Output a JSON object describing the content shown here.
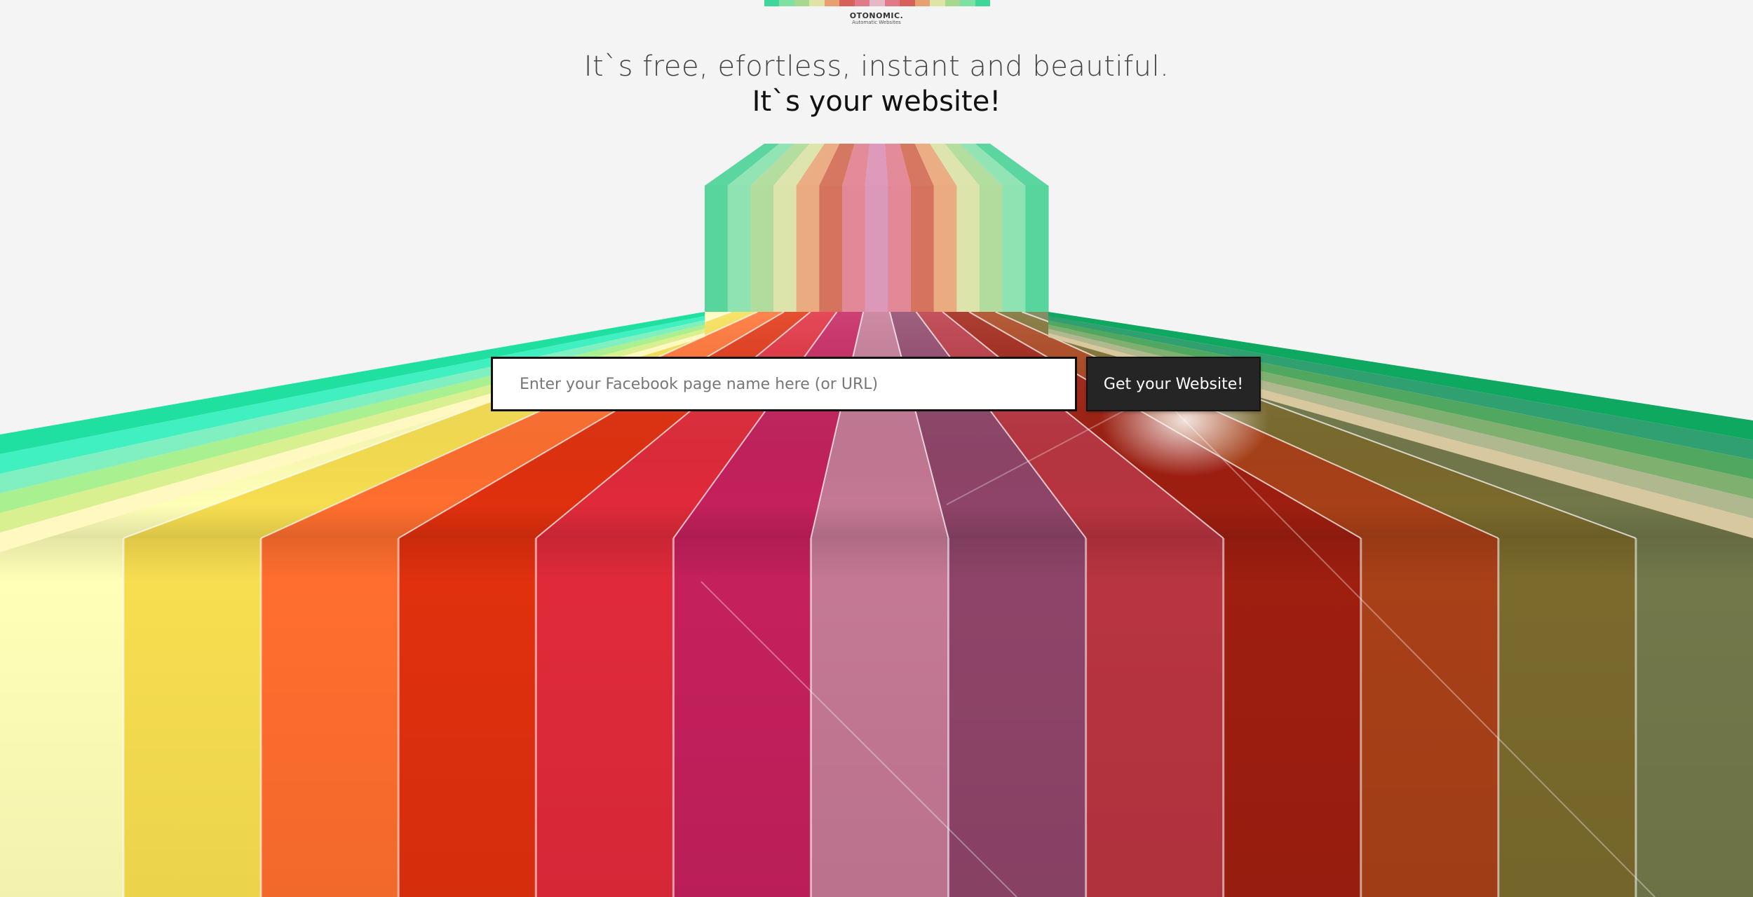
{
  "brand": {
    "name": "OTONOMIC.",
    "tagline": "Automatic Websites"
  },
  "hero": {
    "headline": "It`s free, efortless, instant and beautiful.",
    "subheadline": "It`s your website!"
  },
  "form": {
    "placeholder": "Enter your Facebook page name here (or URL)",
    "value": "",
    "submit_label": "Get your Website!"
  },
  "palette": [
    "#ffffb8",
    "#f7de50",
    "#ff6e2e",
    "#e0300e",
    "#e02a3a",
    "#c4205c",
    "#c47894",
    "#8e4468",
    "#b83440",
    "#9e1e10",
    "#a84018",
    "#7a6a2c",
    "#72784a"
  ]
}
